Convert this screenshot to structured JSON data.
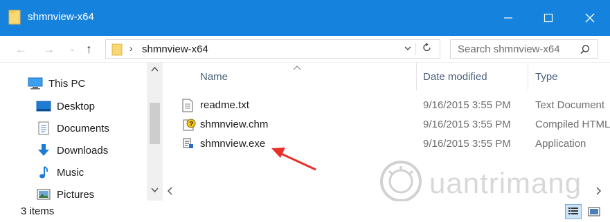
{
  "window": {
    "title": "shmnview-x64",
    "controls": {
      "minimize": "—",
      "maximize": "☐",
      "close": "✕"
    }
  },
  "address": {
    "path": "shmnview-x64",
    "separator": "›",
    "search_placeholder": "Search shmnview-x64"
  },
  "nav": {
    "back": "←",
    "forward": "→",
    "dropdown": "⌄",
    "up": "↑"
  },
  "sidebar": {
    "items": [
      {
        "label": "This PC",
        "icon": "computer-icon"
      },
      {
        "label": "Desktop",
        "icon": "desktop-icon"
      },
      {
        "label": "Documents",
        "icon": "documents-icon"
      },
      {
        "label": "Downloads",
        "icon": "downloads-icon"
      },
      {
        "label": "Music",
        "icon": "music-icon"
      },
      {
        "label": "Pictures",
        "icon": "pictures-icon"
      }
    ]
  },
  "columns": {
    "name": "Name",
    "date": "Date modified",
    "type": "Type"
  },
  "files": [
    {
      "name": "readme.txt",
      "date": "9/16/2015 3:55 PM",
      "type": "Text Document",
      "icon": "text-file-icon"
    },
    {
      "name": "shmnview.chm",
      "date": "9/16/2015 3:55 PM",
      "type": "Compiled HTML",
      "icon": "help-file-icon"
    },
    {
      "name": "shmnview.exe",
      "date": "9/16/2015 3:55 PM",
      "type": "Application",
      "icon": "exe-file-icon"
    }
  ],
  "status": {
    "item_count": "3 items"
  },
  "watermark": {
    "text": "uantrimang"
  },
  "colors": {
    "titlebar": "#1583de",
    "arrow": "#e8302a",
    "header_text": "#4c607a"
  }
}
